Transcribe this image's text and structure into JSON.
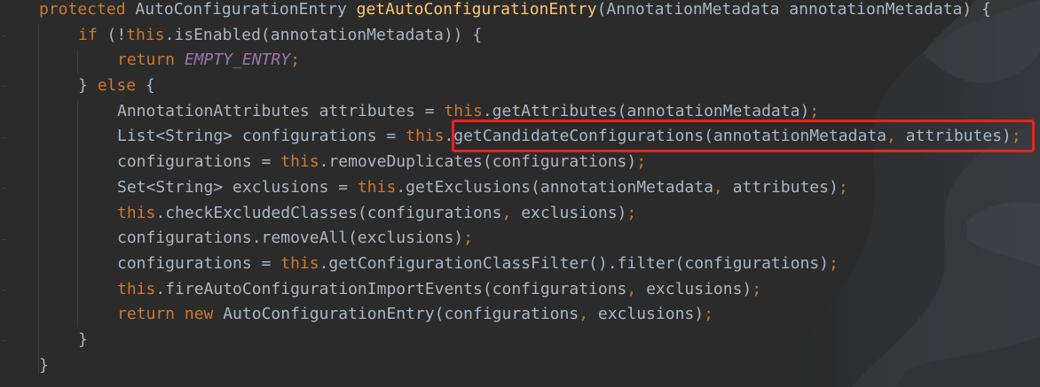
{
  "editor": {
    "theme_colors": {
      "background": "#2b2b2b",
      "keyword": "#cc7832",
      "method_declaration": "#ffc66d",
      "constant": "#9876aa",
      "plain": "#a9b7c6",
      "highlight_box": "#e8231b"
    },
    "lines": [
      {
        "tokens": [
          {
            "text": "protected ",
            "kind": "kw"
          },
          {
            "text": "AutoConfigurationEntry ",
            "kind": "pl"
          },
          {
            "text": "getAutoConfigurationEntry",
            "kind": "fn"
          },
          {
            "text": "(AnnotationMetadata annotationMetadata) {",
            "kind": "pl"
          }
        ]
      },
      {
        "tokens": [
          {
            "text": "if ",
            "kind": "kw"
          },
          {
            "text": "(!",
            "kind": "pl"
          },
          {
            "text": "this",
            "kind": "kw"
          },
          {
            "text": ".isEnabled(annotationMetadata)) {",
            "kind": "pl"
          }
        ]
      },
      {
        "tokens": [
          {
            "text": "return ",
            "kind": "kw"
          },
          {
            "text": "EMPTY_ENTRY",
            "kind": "cn"
          },
          {
            "text": ";",
            "kind": "kw"
          }
        ]
      },
      {
        "tokens": [
          {
            "text": "} ",
            "kind": "pl"
          },
          {
            "text": "else ",
            "kind": "kw"
          },
          {
            "text": "{",
            "kind": "pl"
          }
        ]
      },
      {
        "tokens": [
          {
            "text": "AnnotationAttributes attributes = ",
            "kind": "pl"
          },
          {
            "text": "this",
            "kind": "kw"
          },
          {
            "text": ".getAttributes(annotationMetadata)",
            "kind": "pl"
          },
          {
            "text": ";",
            "kind": "kw"
          }
        ]
      },
      {
        "tokens": [
          {
            "text": "List<String> configurations = ",
            "kind": "pl"
          },
          {
            "text": "this",
            "kind": "kw"
          },
          {
            "text": ".getCandidateConfigurations(annotationMetadata",
            "kind": "pl"
          },
          {
            "text": ", ",
            "kind": "kw"
          },
          {
            "text": "attributes)",
            "kind": "pl"
          },
          {
            "text": ";",
            "kind": "kw"
          }
        ]
      },
      {
        "tokens": [
          {
            "text": "configurations = ",
            "kind": "pl"
          },
          {
            "text": "this",
            "kind": "kw"
          },
          {
            "text": ".removeDuplicates(configurations)",
            "kind": "pl"
          },
          {
            "text": ";",
            "kind": "kw"
          }
        ]
      },
      {
        "tokens": [
          {
            "text": "Set<String> exclusions = ",
            "kind": "pl"
          },
          {
            "text": "this",
            "kind": "kw"
          },
          {
            "text": ".getExclusions(annotationMetadata",
            "kind": "pl"
          },
          {
            "text": ", ",
            "kind": "kw"
          },
          {
            "text": "attributes)",
            "kind": "pl"
          },
          {
            "text": ";",
            "kind": "kw"
          }
        ]
      },
      {
        "tokens": [
          {
            "text": "this",
            "kind": "kw"
          },
          {
            "text": ".checkExcludedClasses(configurations",
            "kind": "pl"
          },
          {
            "text": ", ",
            "kind": "kw"
          },
          {
            "text": "exclusions)",
            "kind": "pl"
          },
          {
            "text": ";",
            "kind": "kw"
          }
        ]
      },
      {
        "tokens": [
          {
            "text": "configurations.removeAll(exclusions)",
            "kind": "pl"
          },
          {
            "text": ";",
            "kind": "kw"
          }
        ]
      },
      {
        "tokens": [
          {
            "text": "configurations = ",
            "kind": "pl"
          },
          {
            "text": "this",
            "kind": "kw"
          },
          {
            "text": ".getConfigurationClassFilter().filter(configurations)",
            "kind": "pl"
          },
          {
            "text": ";",
            "kind": "kw"
          }
        ]
      },
      {
        "tokens": [
          {
            "text": "this",
            "kind": "kw"
          },
          {
            "text": ".fireAutoConfigurationImportEvents(configurations",
            "kind": "pl"
          },
          {
            "text": ", ",
            "kind": "kw"
          },
          {
            "text": "exclusions)",
            "kind": "pl"
          },
          {
            "text": ";",
            "kind": "kw"
          }
        ]
      },
      {
        "tokens": [
          {
            "text": "return new ",
            "kind": "kw"
          },
          {
            "text": "AutoConfigurationEntry(configurations",
            "kind": "pl"
          },
          {
            "text": ", ",
            "kind": "kw"
          },
          {
            "text": "exclusions)",
            "kind": "pl"
          },
          {
            "text": ";",
            "kind": "kw"
          }
        ]
      },
      {
        "tokens": [
          {
            "text": "}",
            "kind": "pl"
          }
        ]
      },
      {
        "tokens": [
          {
            "text": "}",
            "kind": "pl"
          }
        ]
      }
    ]
  }
}
